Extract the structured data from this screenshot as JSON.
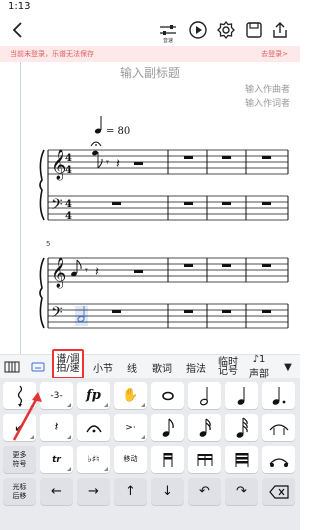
{
  "statusbar": {
    "time": "1:13"
  },
  "header": {
    "speed_label": "音速",
    "icons": [
      "back-icon",
      "speed-icon",
      "play-icon",
      "settings-icon",
      "save-icon",
      "export-icon"
    ]
  },
  "login_banner": {
    "message": "当前未登录，乐谱无法保存",
    "action": "去登录>"
  },
  "score": {
    "subtitle": "输入副标题",
    "composer": "输入作曲者",
    "lyricist": "输入作词者",
    "tempo": "= 80",
    "measure_number": "5",
    "time_signature_top": "4",
    "time_signature_bottom": "4"
  },
  "toolbar": {
    "tabs": [
      {
        "label_1": "谱/调",
        "label_2": "拍/速"
      },
      {
        "label": "小节"
      },
      {
        "label": "线"
      },
      {
        "label": "歌词"
      },
      {
        "label": "指法"
      },
      {
        "label_1": "临时",
        "label_2": "记号"
      },
      {
        "label": "声部"
      }
    ],
    "voice_number": "1"
  },
  "keypad": {
    "more_symbols": "更多\n符号",
    "move": "移动",
    "cursor_back_1": "光标",
    "cursor_back_2": "后移",
    "more_1": "更多",
    "more_2": "符号",
    "dynamic": "fp",
    "tuplet": "-3-",
    "trill": "tr"
  },
  "colors": {
    "accent_blue": "#3a6fd8",
    "highlight_red": "#e33333",
    "banner_bg": "#fde9e9",
    "banner_text": "#e25c5c"
  }
}
